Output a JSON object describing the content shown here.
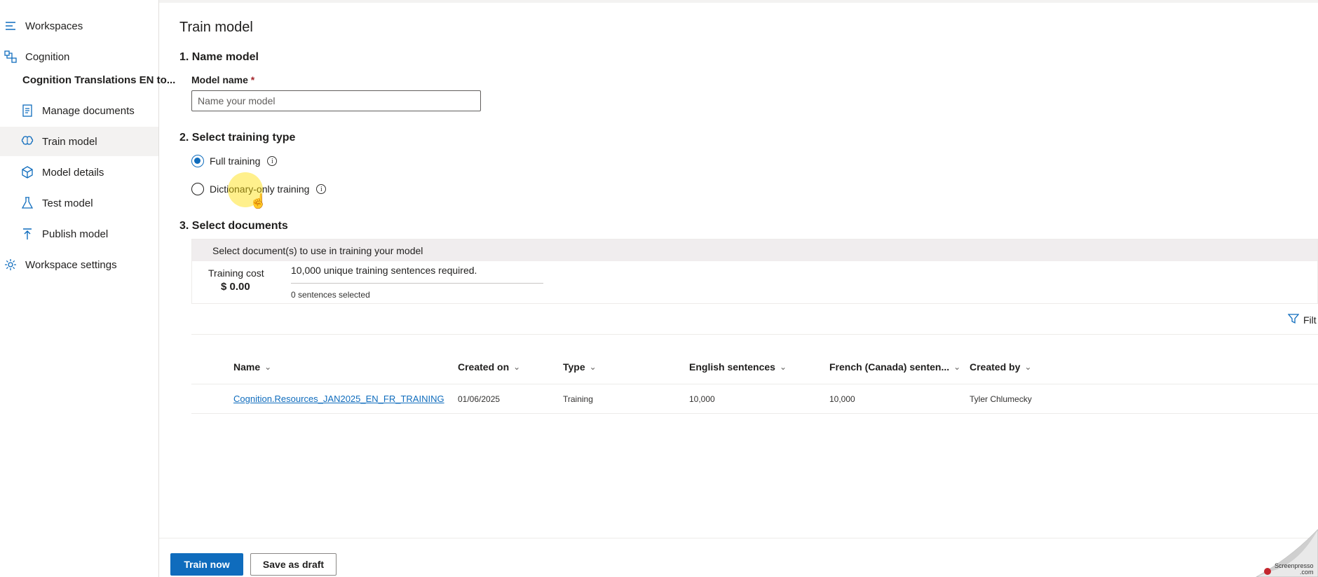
{
  "sidebar": {
    "workspaces": "Workspaces",
    "cognition": "Cognition",
    "project": "Cognition Translations EN to...",
    "items": [
      {
        "label": "Manage documents"
      },
      {
        "label": "Train model"
      },
      {
        "label": "Model details"
      },
      {
        "label": "Test model"
      },
      {
        "label": "Publish model"
      }
    ],
    "workspace_settings": "Workspace settings"
  },
  "page": {
    "title": "Train model",
    "step1": "1. Name model",
    "model_name_label": "Model name",
    "required_mark": "*",
    "model_name_placeholder": "Name your model",
    "model_name_value": "",
    "step2": "2. Select training type",
    "full_training": "Full training",
    "dictionary_training": "Dictionary-only training",
    "info_glyph": "i",
    "selected_training": "full",
    "step3": "3. Select documents"
  },
  "documents": {
    "panel_title": "Select document(s) to use in training your model",
    "cost_label": "Training cost",
    "cost_value": "$ 0.00",
    "requirement": "10,000 unique training sentences required.",
    "selected": "0 sentences selected",
    "filter": "Filt",
    "columns": [
      "Name",
      "Created on",
      "Type",
      "English sentences",
      "French (Canada) senten...",
      "Created by"
    ],
    "rows": [
      [
        "Cognition.Resources_JAN2025_EN_FR_TRAINING",
        "01/06/2025",
        "Training",
        "10,000",
        "10,000",
        "Tyler Chlumecky"
      ]
    ]
  },
  "footer": {
    "train_now": "Train now",
    "save_draft": "Save as draft"
  },
  "watermark": {
    "line1": "Screenpresso",
    "line2": ".com"
  },
  "colors": {
    "accent": "#0f6cbd",
    "highlight": "#ffdd00",
    "nav_active": "#f3f2f1"
  },
  "icons": [
    "hamburger-icon",
    "cognition-icon",
    "document-icon",
    "brain-icon",
    "cube-icon",
    "beaker-icon",
    "publish-icon",
    "gear-icon",
    "info-icon",
    "filter-icon",
    "chevron-down-icon"
  ]
}
